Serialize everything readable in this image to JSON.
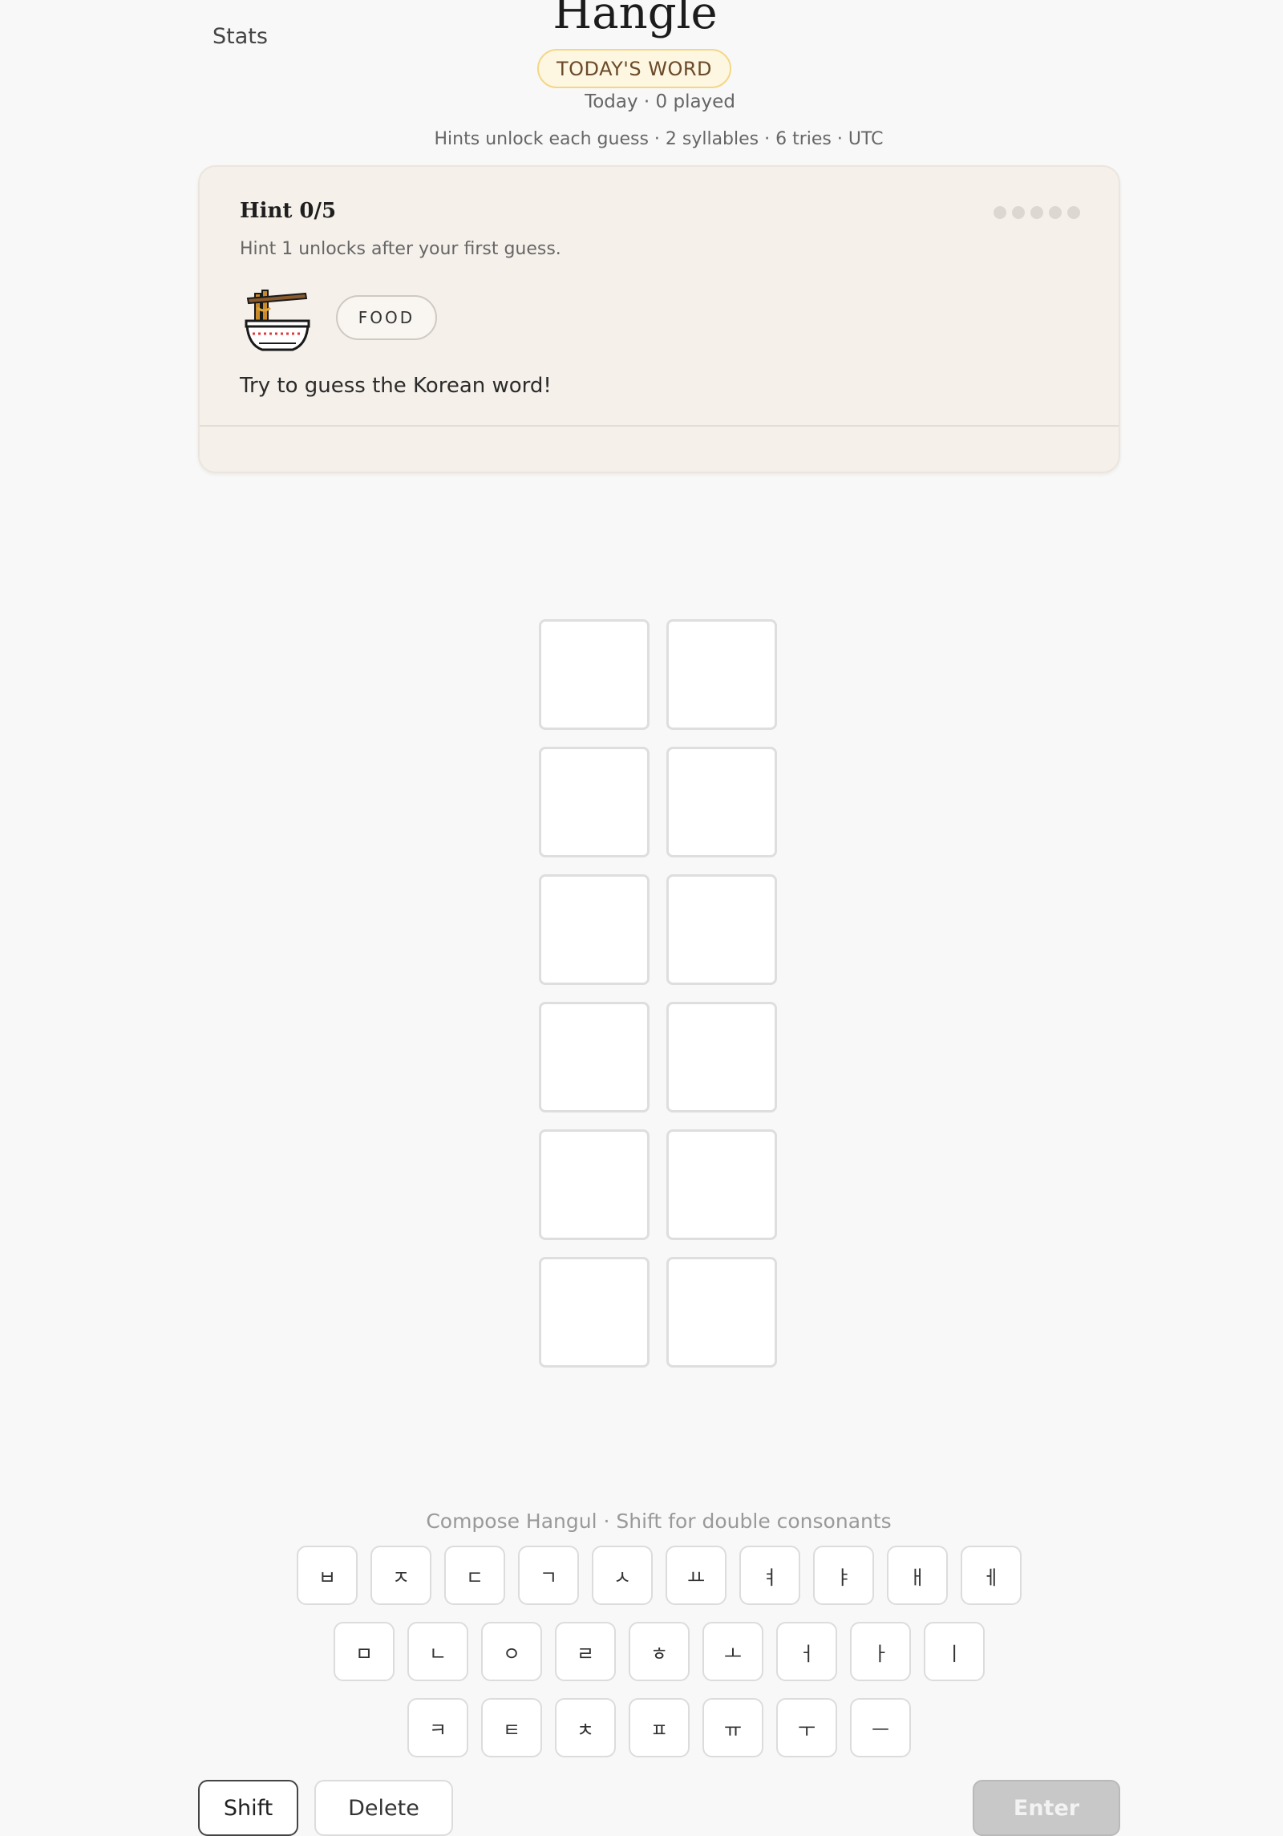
{
  "header": {
    "stats_label": "Stats",
    "title": "Hangle",
    "badge": "TODAY'S WORD",
    "played": "Today · 0 played",
    "rules": "Hints unlock each guess · 2 syllables · 6 tries · UTC"
  },
  "hint_card": {
    "title": "Hint 0/5",
    "subtitle": "Hint 1 unlocks after your first guess.",
    "category": "FOOD",
    "category_icon": "noodle-bowl-icon",
    "text": "Try to guess the Korean word!",
    "hints_unlocked": 0,
    "hints_total": 5
  },
  "board": {
    "rows": 6,
    "syllables": 2
  },
  "keyboard": {
    "hint": "Compose Hangul · Shift for double consonants",
    "row1": [
      "ㅂ",
      "ㅈ",
      "ㄷ",
      "ㄱ",
      "ㅅ",
      "ㅛ",
      "ㅕ",
      "ㅑ",
      "ㅐ",
      "ㅔ"
    ],
    "row2": [
      "ㅁ",
      "ㄴ",
      "ㅇ",
      "ㄹ",
      "ㅎ",
      "ㅗ",
      "ㅓ",
      "ㅏ",
      "ㅣ"
    ],
    "row3": [
      "ㅋ",
      "ㅌ",
      "ㅊ",
      "ㅍ",
      "ㅠ",
      "ㅜ",
      "ㅡ"
    ],
    "shift_label": "Shift",
    "delete_label": "Delete",
    "enter_label": "Enter"
  }
}
